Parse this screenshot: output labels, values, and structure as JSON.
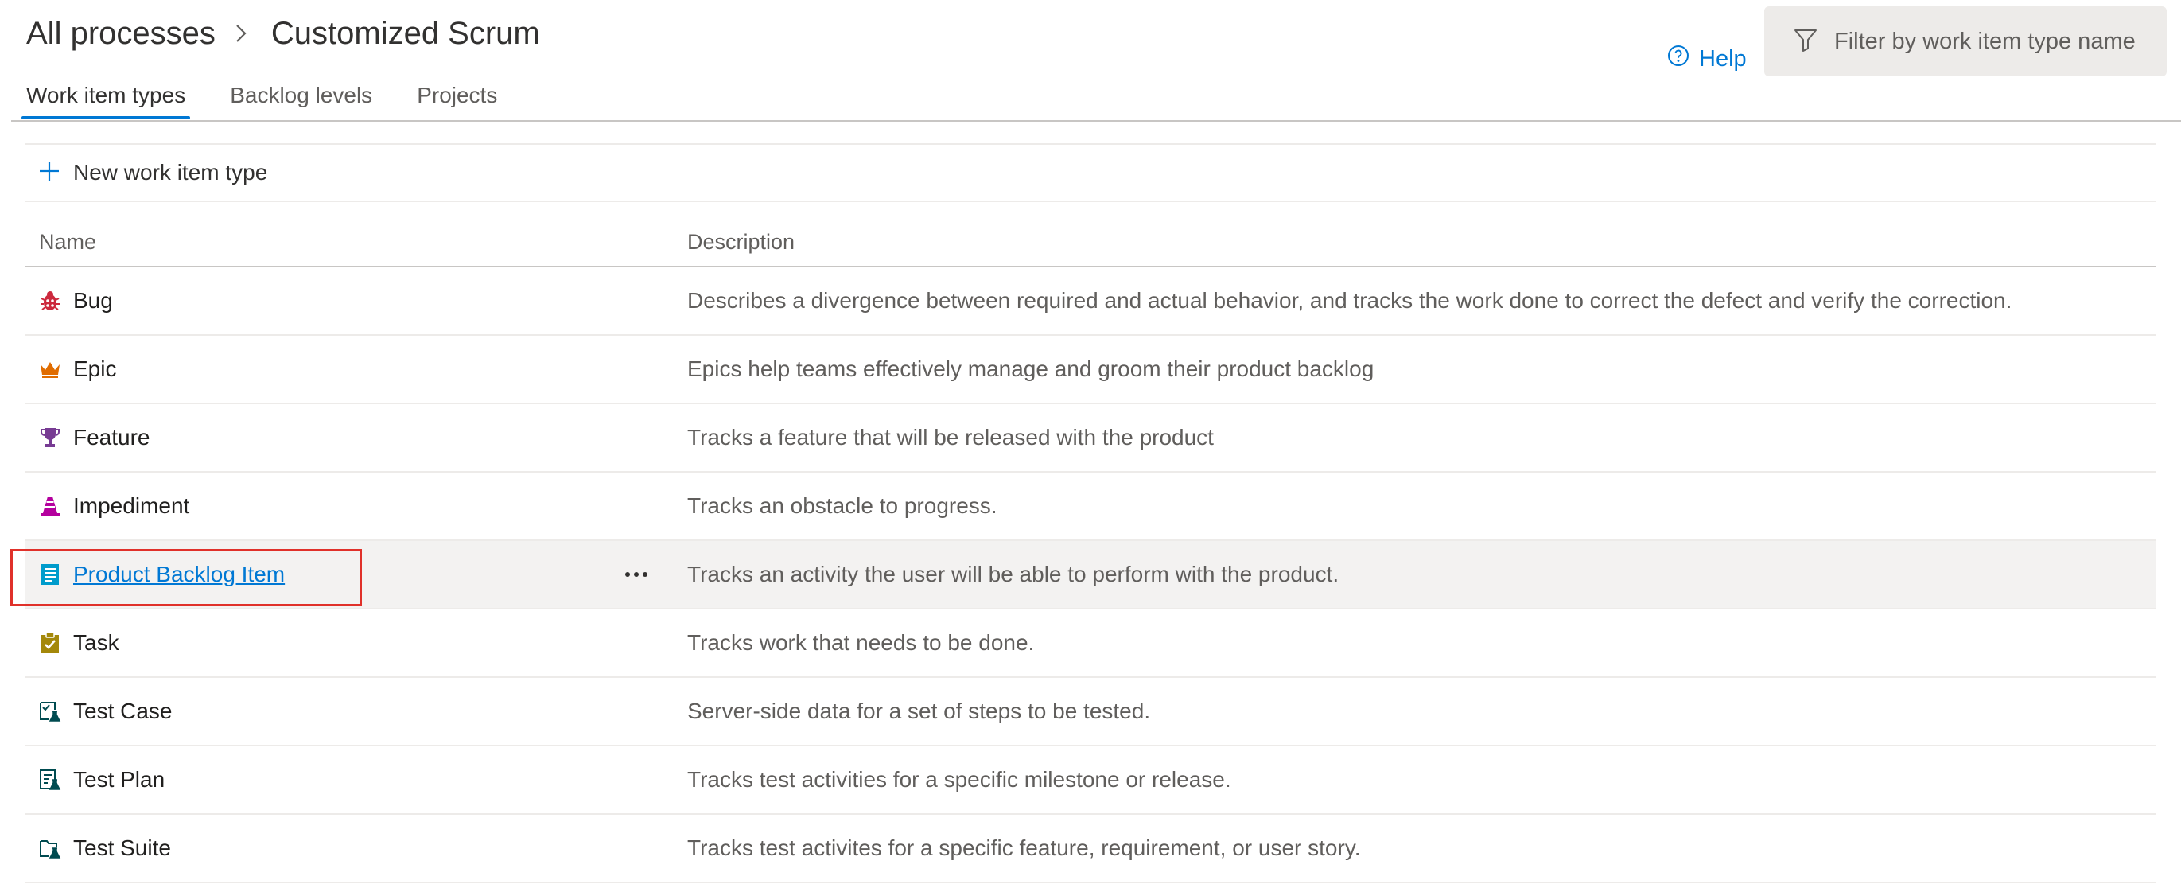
{
  "breadcrumb": {
    "root": "All processes",
    "current": "Customized Scrum"
  },
  "tabs": [
    {
      "label": "Work item types",
      "active": true
    },
    {
      "label": "Backlog levels",
      "active": false
    },
    {
      "label": "Projects",
      "active": false
    }
  ],
  "help": {
    "label": "Help",
    "icon": "help-circle-icon"
  },
  "filter": {
    "placeholder": "Filter by work item type name",
    "icon": "filter-icon"
  },
  "toolbar": {
    "new_label": "New work item type",
    "icon": "plus-icon"
  },
  "table": {
    "columns": [
      "Name",
      "Description"
    ],
    "rows": [
      {
        "name": "Bug",
        "icon": "bug-icon",
        "color": "#cc293d",
        "description": "Describes a divergence between required and actual behavior, and tracks the work done to correct the defect and verify the correction."
      },
      {
        "name": "Epic",
        "icon": "crown-icon",
        "color": "#e06c00",
        "description": "Epics help teams effectively manage and groom their product backlog"
      },
      {
        "name": "Feature",
        "icon": "trophy-icon",
        "color": "#773b93",
        "description": "Tracks a feature that will be released with the product"
      },
      {
        "name": "Impediment",
        "icon": "traffic-cone-icon",
        "color": "#b4009e",
        "description": "Tracks an obstacle to progress."
      },
      {
        "name": "Product Backlog Item",
        "icon": "list-icon",
        "color": "#009ccc",
        "description": "Tracks an activity the user will be able to perform with the product.",
        "selected": true
      },
      {
        "name": "Task",
        "icon": "clipboard-check-icon",
        "color": "#a4880a",
        "description": "Tracks work that needs to be done."
      },
      {
        "name": "Test Case",
        "icon": "test-case-icon",
        "color": "#004b50",
        "description": "Server-side data for a set of steps to be tested."
      },
      {
        "name": "Test Plan",
        "icon": "test-plan-icon",
        "color": "#004b50",
        "description": "Tracks test activities for a specific milestone or release."
      },
      {
        "name": "Test Suite",
        "icon": "test-suite-icon",
        "color": "#004b50",
        "description": "Tracks test activites for a specific feature, requirement, or user story."
      }
    ]
  },
  "colors": {
    "accent": "#0078d4",
    "highlight_box": "#e0312a"
  }
}
